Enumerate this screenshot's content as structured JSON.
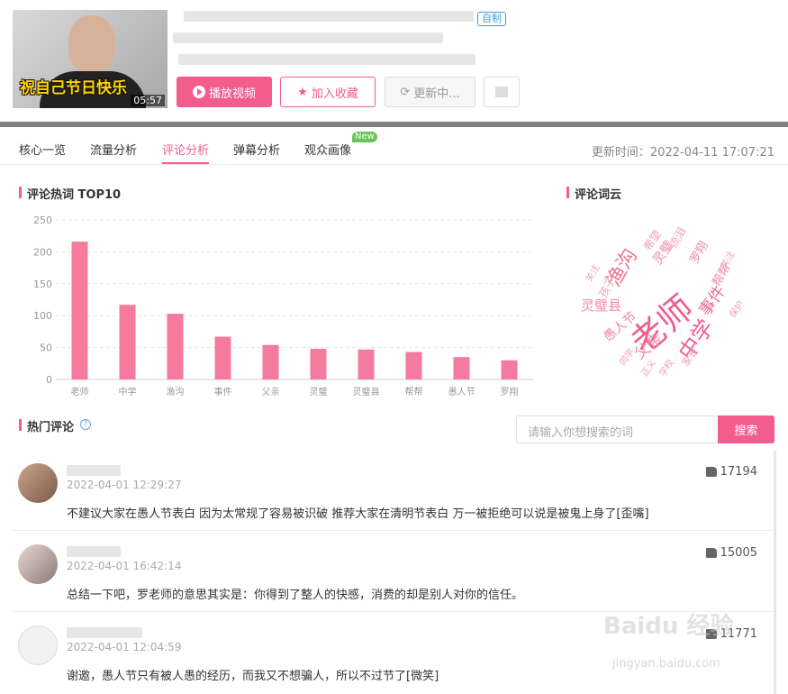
{
  "video": {
    "caption": "祝自己节日快乐",
    "duration": "05:57",
    "badge": "自制"
  },
  "actions": {
    "play": "播放视频",
    "favorite": "加入收藏",
    "update": "更新中..."
  },
  "tabs": [
    {
      "label": "核心一览"
    },
    {
      "label": "流量分析"
    },
    {
      "label": "评论分析"
    },
    {
      "label": "弹幕分析"
    },
    {
      "label": "观众画像"
    }
  ],
  "new_badge": "New",
  "updated_time": "更新时间：2022-04-11 17:07:21",
  "chart_section_title": "评论热词 TOP10",
  "wordcloud_title": "评论词云",
  "chart_data": {
    "type": "bar",
    "categories": [
      "老师",
      "中学",
      "渔沟",
      "事件",
      "父亲",
      "灵璧",
      "灵璧县",
      "帮帮",
      "愚人节",
      "罗翔"
    ],
    "values": [
      216,
      117,
      103,
      67,
      54,
      48,
      47,
      43,
      35,
      30
    ],
    "ylim": [
      0,
      250
    ],
    "yticks": [
      0,
      50,
      100,
      150,
      200,
      250
    ],
    "color": "#f47a9f",
    "grid": true
  },
  "wordcloud": [
    "老师",
    "渔沟",
    "中学",
    "事件",
    "灵璧县",
    "父亲",
    "愚人节",
    "灵璧",
    "帮帮",
    "罗翔",
    "希望",
    "流泪",
    "孩子",
    "学校",
    "正义",
    "保护",
    "同学",
    "家长",
    "关注",
    "关注"
  ],
  "hot_comments_title": "热门评论",
  "search": {
    "placeholder": "请输入你想搜索的词",
    "button": "搜索"
  },
  "comments": [
    {
      "time": "2022-04-01 12:29:27",
      "text": "不建议大家在愚人节表白 因为太常规了容易被识破 推荐大家在清明节表白 万一被拒绝可以说是被鬼上身了[歪嘴]",
      "likes": "17194"
    },
    {
      "time": "2022-04-01 16:42:14",
      "text": "总结一下吧，罗老师的意思其实是：你得到了整人的快感，消费的却是别人对你的信任。",
      "likes": "15005"
    },
    {
      "time": "2022-04-01 12:04:59",
      "text": "谢邀，愚人节只有被人愚的经历，而我又不想骗人，所以不过节了[微笑]",
      "likes": "11771"
    }
  ],
  "watermark": "Baidu 经验",
  "watermark_url": "jingyan.baidu.com"
}
